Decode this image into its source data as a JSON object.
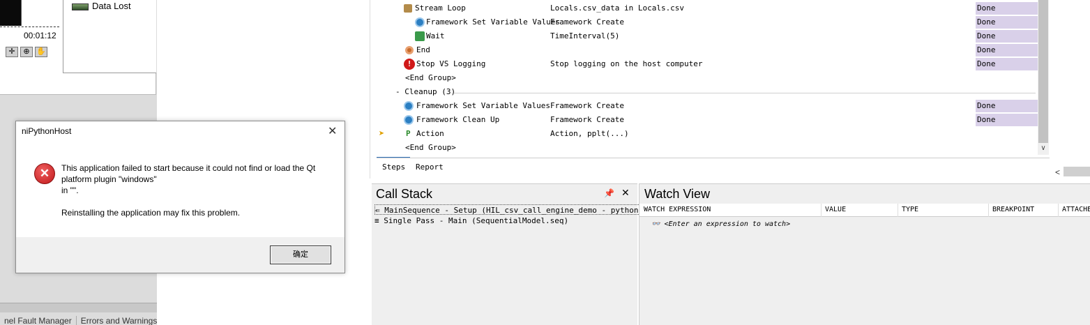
{
  "left_panel": {
    "legend_label": "Data Lost",
    "timer": "00:01:12",
    "tabs": [
      "nel Fault Manager",
      "Errors and Warnings"
    ]
  },
  "steps": {
    "rows": [
      {
        "name": "Stream Loop",
        "desc": "Locals.csv_data in Locals.csv",
        "status": "Done",
        "icon": "stream-loop-icon"
      },
      {
        "name": "Framework Set Variable Values",
        "desc": "Framework Create",
        "status": "Done",
        "icon": "gear-icon"
      },
      {
        "name": "Wait",
        "desc": "TimeInterval(5)",
        "status": "Done",
        "icon": "hourglass-icon"
      },
      {
        "name": "End",
        "desc": "",
        "status": "Done",
        "icon": "end-icon"
      },
      {
        "name": "Stop VS Logging",
        "desc": "Stop logging on the host computer",
        "status": "Done",
        "icon": "error-icon"
      },
      {
        "name": "<End Group>",
        "desc": "",
        "status": "",
        "icon": ""
      },
      {
        "name": "- Cleanup (3)",
        "desc": "",
        "status": "",
        "icon": ""
      },
      {
        "name": "Framework Set Variable Values",
        "desc": "Framework Create",
        "status": "Done",
        "icon": "gear-icon"
      },
      {
        "name": "Framework Clean Up",
        "desc": "Framework Create",
        "status": "Done",
        "icon": "gear-icon"
      },
      {
        "name": "Action",
        "desc": "Action,  pplt(...)",
        "status": "",
        "icon": "action-icon"
      },
      {
        "name": "<End Group>",
        "desc": "",
        "status": "",
        "icon": ""
      }
    ],
    "tabs": {
      "steps": "Steps",
      "report": "Report"
    }
  },
  "call_stack": {
    "title": "Call Stack",
    "rows": [
      "MainSequence - Setup (HIL_csv_call_engine_demo - python.seq)",
      "Single Pass - Main (SequentialModel.seq)"
    ]
  },
  "watch_view": {
    "title": "Watch View",
    "columns": [
      "WATCH EXPRESSION",
      "VALUE",
      "TYPE",
      "BREAKPOINT",
      "ATTACHE"
    ],
    "placeholder_row": "<Enter an expression to watch>"
  },
  "dialog": {
    "title": "niPythonHost",
    "message": "This application failed to start because it could not find or load the Qt\nplatform plugin \"windows\"\nin \"\".\n\nReinstalling the application may fix this problem.",
    "ok_label": "确定"
  },
  "colors": {
    "status_bg": "#d9d0e9",
    "error_red": "#c0181a",
    "accent_blue": "#2c6fb7"
  }
}
